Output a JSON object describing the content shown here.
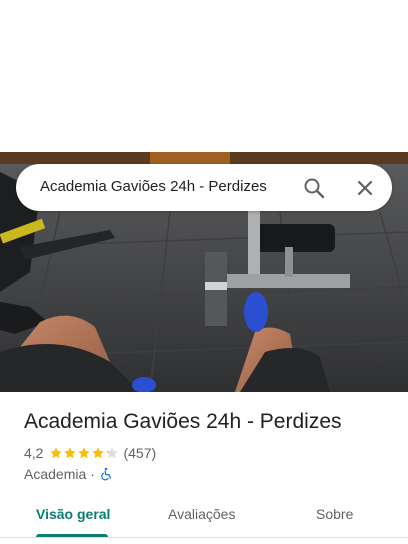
{
  "search": {
    "query": "Academia Gaviões 24h - Perdizes"
  },
  "place": {
    "name": "Academia Gaviões 24h - Perdizes",
    "rating": "4,2",
    "rating_value": 4.2,
    "rating_max": 5,
    "review_count": "(457)",
    "category": "Academia",
    "separator": "·"
  },
  "tabs": [
    {
      "label": "Visão geral",
      "active": true
    },
    {
      "label": "Avaliações",
      "active": false
    },
    {
      "label": "Sobre",
      "active": false
    }
  ],
  "colors": {
    "accent": "#0a7d72",
    "star": "#fbbc04",
    "star_empty": "#dadce0",
    "accessibility": "#1a73e8"
  },
  "icons": {
    "search": "search-icon",
    "close": "close-icon",
    "accessibility": "wheelchair-icon"
  }
}
